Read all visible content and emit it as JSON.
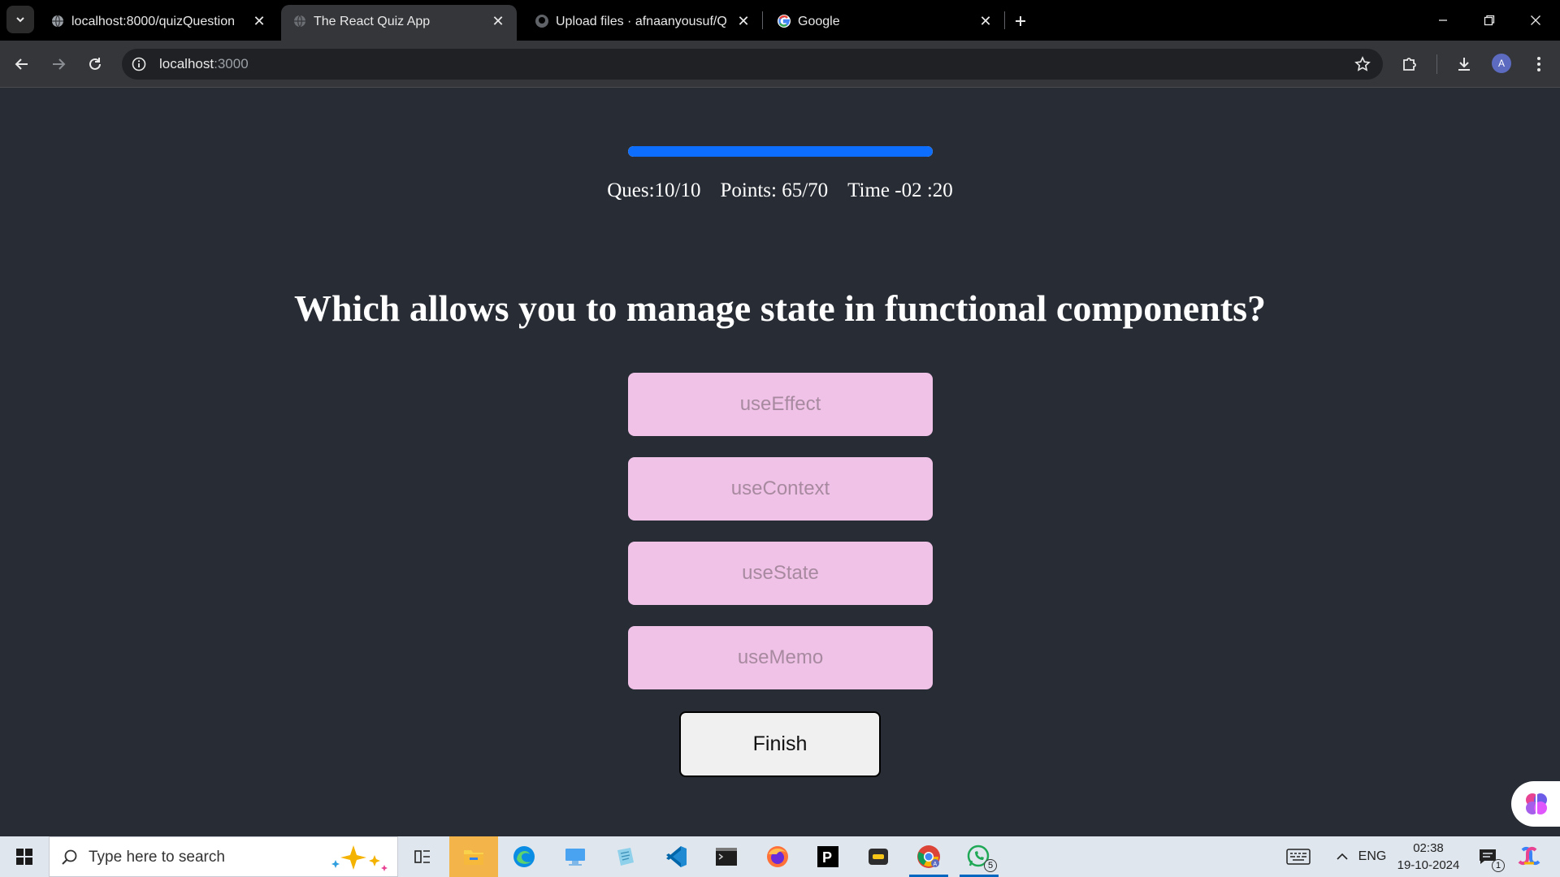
{
  "browser": {
    "tabs": [
      {
        "title": "localhost:8000/quizQuestion",
        "active": false
      },
      {
        "title": "The React Quiz App",
        "active": true
      },
      {
        "title": "Upload files · afnaanyousuf/Qui",
        "active": false
      },
      {
        "title": "Google",
        "active": false
      }
    ],
    "url_host": "localhost",
    "url_port": ":3000",
    "profile_initial": "A"
  },
  "quiz": {
    "progress_fraction": 1.0,
    "question_counter": "Ques:10/10",
    "points": "Points: 65/70",
    "timer": "Time -02 :20",
    "question": "Which allows you to manage state in functional components?",
    "options": [
      "useEffect",
      "useContext",
      "useState",
      "useMemo"
    ],
    "finish_label": "Finish"
  },
  "taskbar": {
    "search_placeholder": "Type here to search",
    "language": "ENG",
    "time": "02:38",
    "date": "19-10-2024",
    "notification_count": "1",
    "whatsapp_badge": "5",
    "apps": [
      "task-view-icon",
      "file-explorer-icon",
      "edge-icon",
      "computer-icon",
      "document-icon",
      "vscode-icon",
      "terminal-icon",
      "firefox-icon",
      "pycharm-icon",
      "game-icon",
      "chrome-icon",
      "whatsapp-icon"
    ]
  },
  "colors": {
    "page_bg": "#282c34",
    "progress": "#0d6efd",
    "option_bg": "#f0c2e7",
    "option_text": "#a88aa0"
  }
}
